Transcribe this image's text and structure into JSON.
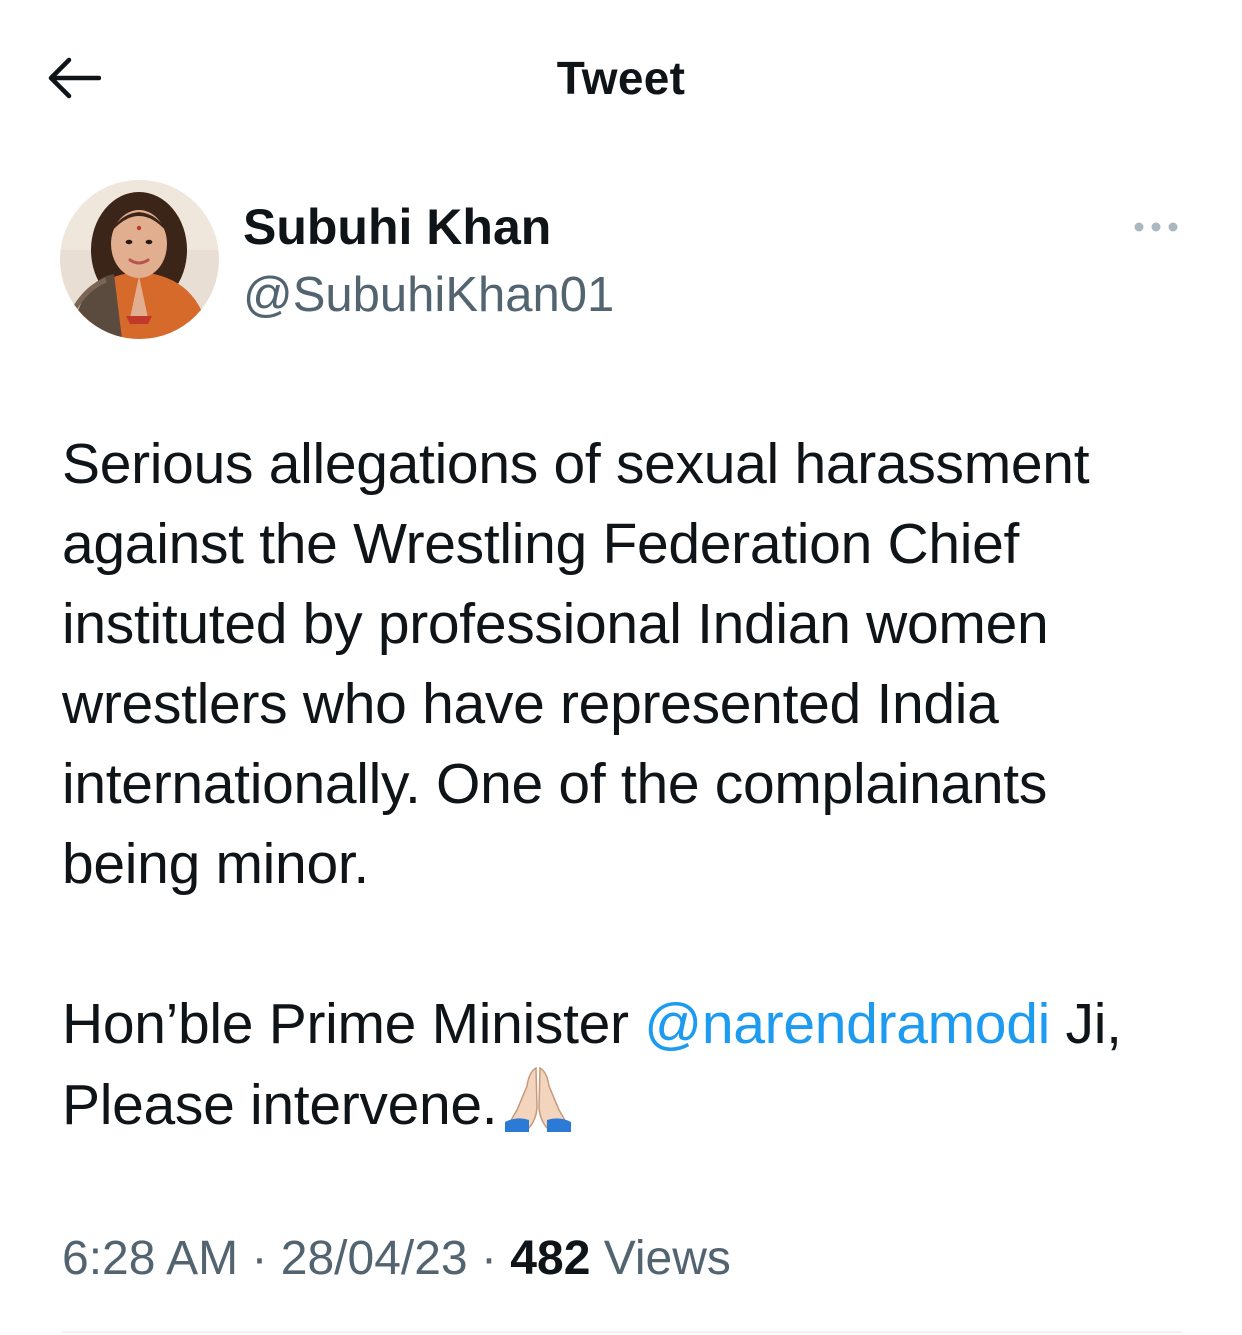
{
  "header": {
    "title": "Tweet",
    "back_icon": "arrow-left-icon"
  },
  "author": {
    "name": "Subuhi Khan",
    "handle": "@SubuhiKhan01",
    "avatar": "profile-photo"
  },
  "more_icon": "ellipsis-icon",
  "tweet": {
    "lines": [
      "Serious allegations of sexual harassment",
      "against the Wrestling Federation Chief",
      "instituted by professional Indian women",
      "wrestlers who have represented India",
      "internationally. One of the complainants",
      "being minor."
    ],
    "prefix": "Hon’ble Prime Minister",
    "mention": "@narendramodi",
    "suffix": "Ji,",
    "last_line": "Please intervene.",
    "emoji": "folded-hands-emoji"
  },
  "meta": {
    "time": "6:28 AM",
    "separator": "·",
    "date": "28/04/23",
    "views_count": "482",
    "views_label": "Views"
  },
  "colors": {
    "text": "#0f1419",
    "secondary": "#536471",
    "link": "#1d9bf0",
    "divider": "#eff3f4"
  }
}
